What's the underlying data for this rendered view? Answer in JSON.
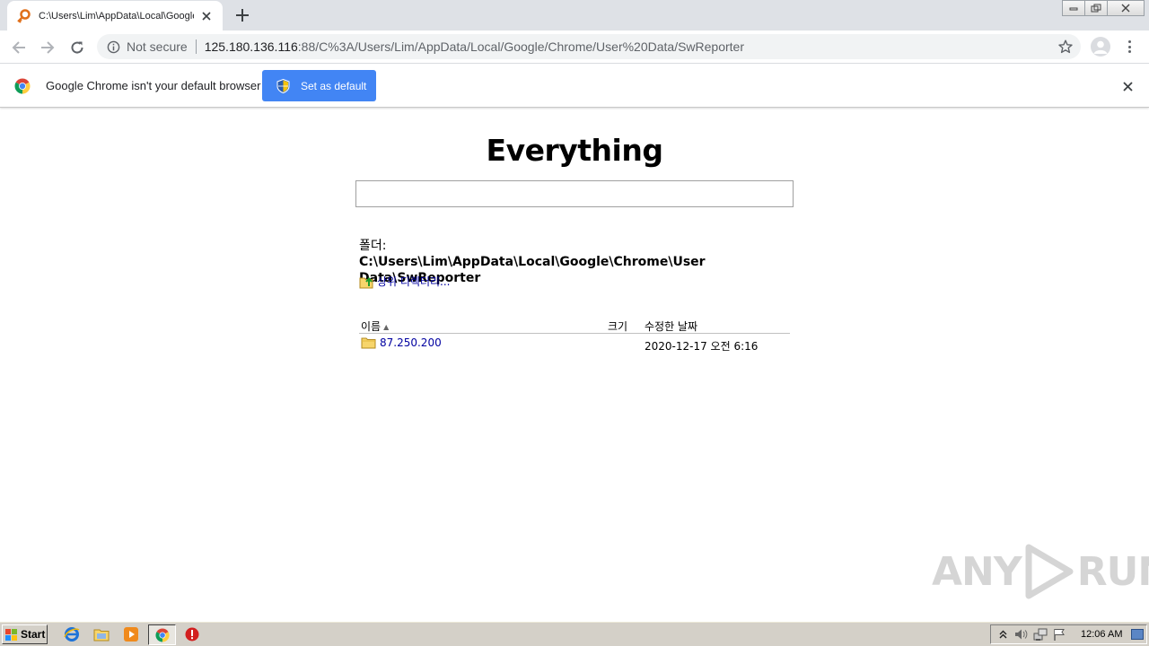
{
  "browser": {
    "tab": {
      "title": "C:\\Users\\Lim\\AppData\\Local\\Google\\Chrome\\User Data\\SwReporter",
      "close_icon": "close-icon",
      "favicon": "key-icon"
    },
    "new_tab_label": "+",
    "omnibox": {
      "security_label": "Not secure",
      "url_host": "125.180.136.116",
      "url_rest": ":88/C%3A/Users/Lim/AppData/Local/Google/Chrome/User%20Data/SwReporter"
    },
    "infobar": {
      "message": "Google Chrome isn't your default browser",
      "button_label": "Set as default",
      "button_color": "#4285f4"
    }
  },
  "page": {
    "title": "Everything",
    "search": {
      "value": ""
    },
    "folder_label": "폴더:",
    "folder_path": "C:\\Users\\Lim\\AppData\\Local\\Google\\Chrome\\User Data\\SwReporter",
    "parent_link": "상위 디렉터리...",
    "table": {
      "headers": {
        "name": "이름",
        "size": "크기",
        "date": "수정한 날짜"
      },
      "rows": [
        {
          "name": "87.250.200",
          "size": "",
          "date": "2020-12-17 오전 6:16"
        }
      ]
    },
    "link_color": "#0000a0"
  },
  "watermark": {
    "left": "ANY",
    "right": "RUN"
  },
  "taskbar": {
    "start_label": "Start",
    "clock": "12:06 AM"
  }
}
